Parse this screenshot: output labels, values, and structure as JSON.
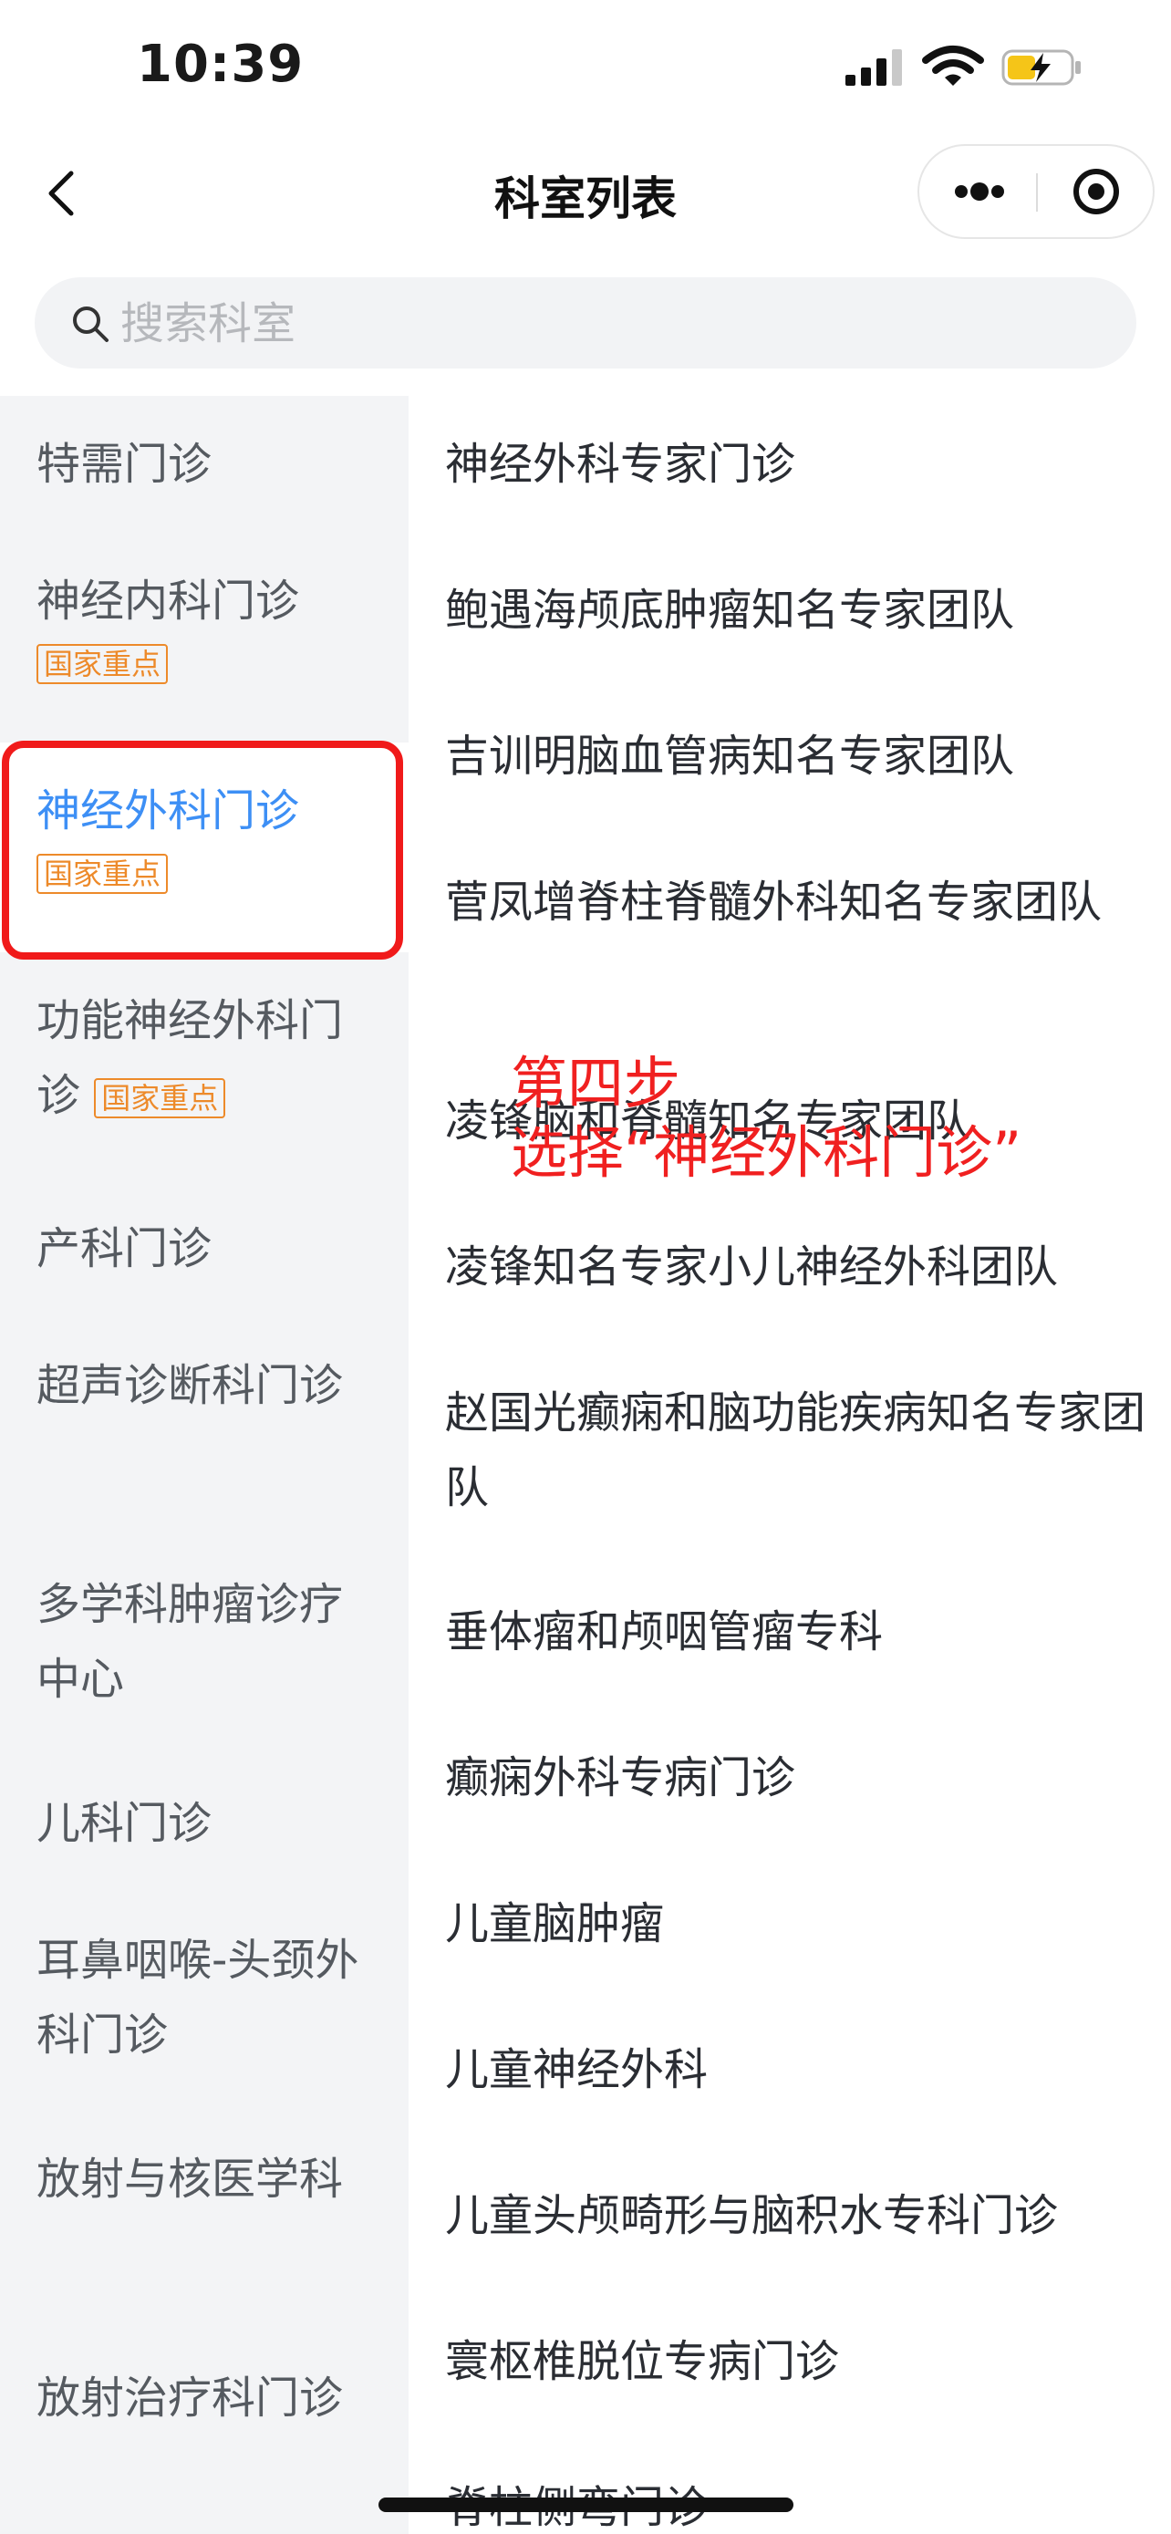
{
  "status_bar": {
    "time": "10:39"
  },
  "nav": {
    "title": "科室列表"
  },
  "search": {
    "placeholder": "搜索科室"
  },
  "sidebar": {
    "items": [
      {
        "label": "特需门诊",
        "tag": ""
      },
      {
        "label": "神经内科门诊",
        "tag": "国家重点"
      },
      {
        "label": "神经外科门诊",
        "tag": "国家重点",
        "selected": true
      },
      {
        "label": "功能神经外科门诊",
        "tag": "国家重点"
      },
      {
        "label": "产科门诊",
        "tag": ""
      },
      {
        "label": "超声诊断科门诊",
        "tag": ""
      },
      {
        "label": "多学科肿瘤诊疗中心",
        "tag": ""
      },
      {
        "label": "儿科门诊",
        "tag": ""
      },
      {
        "label": "耳鼻咽喉-头颈外科门诊",
        "tag": ""
      },
      {
        "label": "放射与核医学科",
        "tag": ""
      },
      {
        "label": "放射治疗科门诊",
        "tag": ""
      }
    ]
  },
  "departments": [
    "神经外科专家门诊",
    "鲍遇海颅底肿瘤知名专家团队",
    "吉训明脑血管病知名专家团队",
    "菅凤增脊柱脊髓外科知名专家团队",
    "凌锋脑和脊髓知名专家团队",
    "凌锋知名专家小儿神经外科团队",
    "赵国光癫痫和脑功能疾病知名专家团队",
    "垂体瘤和颅咽管瘤专科",
    "癫痫外科专病门诊",
    "儿童脑肿瘤",
    "儿童神经外科",
    "儿童头颅畸形与脑积水专科门诊",
    "寰枢椎脱位专病门诊",
    "脊柱侧弯门诊"
  ],
  "annotation": {
    "line1": "第四步",
    "line2": "选择“神经外科门诊”"
  },
  "colors": {
    "selected": "#3d8ff5",
    "tag": "#ed8a2a",
    "highlight": "#f01a1a",
    "sidebar_bg": "#f3f4f6"
  }
}
